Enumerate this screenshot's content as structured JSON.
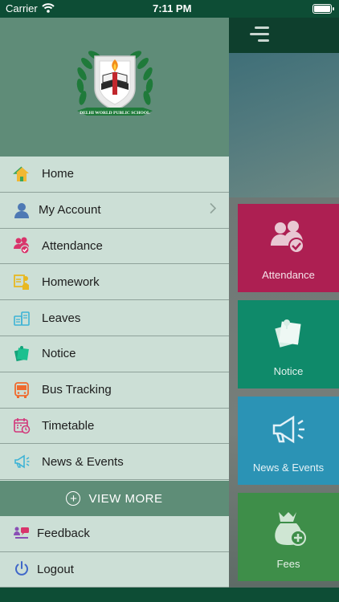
{
  "status_bar": {
    "carrier": "Carrier",
    "time": "7:11 PM"
  },
  "drawer": {
    "logo_text": "DELHI WORLD PUBLIC SCHOOL",
    "menu_items": [
      {
        "label": "Home",
        "icon": "home-icon"
      },
      {
        "label": "My Account",
        "icon": "user-icon",
        "has_chevron": true
      },
      {
        "label": "Attendance",
        "icon": "attendance-icon"
      },
      {
        "label": "Homework",
        "icon": "homework-icon"
      },
      {
        "label": "Leaves",
        "icon": "leaves-icon"
      },
      {
        "label": "Notice",
        "icon": "notice-icon"
      },
      {
        "label": "Bus Tracking",
        "icon": "bus-icon"
      },
      {
        "label": "Timetable",
        "icon": "calendar-icon"
      },
      {
        "label": "News & Events",
        "icon": "megaphone-icon"
      }
    ],
    "view_more": "VIEW MORE",
    "bottom_items": [
      {
        "label": "Feedback",
        "icon": "feedback-icon"
      },
      {
        "label": "Logout",
        "icon": "power-icon"
      }
    ]
  },
  "background": {
    "tiles": [
      {
        "label": "Attendance",
        "color": "#ad1f52"
      },
      {
        "label": "Notice",
        "color": "#0f8a6a"
      },
      {
        "label": "News & Events",
        "color": "#2b93b5"
      },
      {
        "label": "Fees",
        "color": "#3e8e49"
      }
    ]
  },
  "colors": {
    "primary_dark": "#0d4d35",
    "drawer_header": "#5f8c78",
    "drawer_bg": "#ccdfd6"
  }
}
